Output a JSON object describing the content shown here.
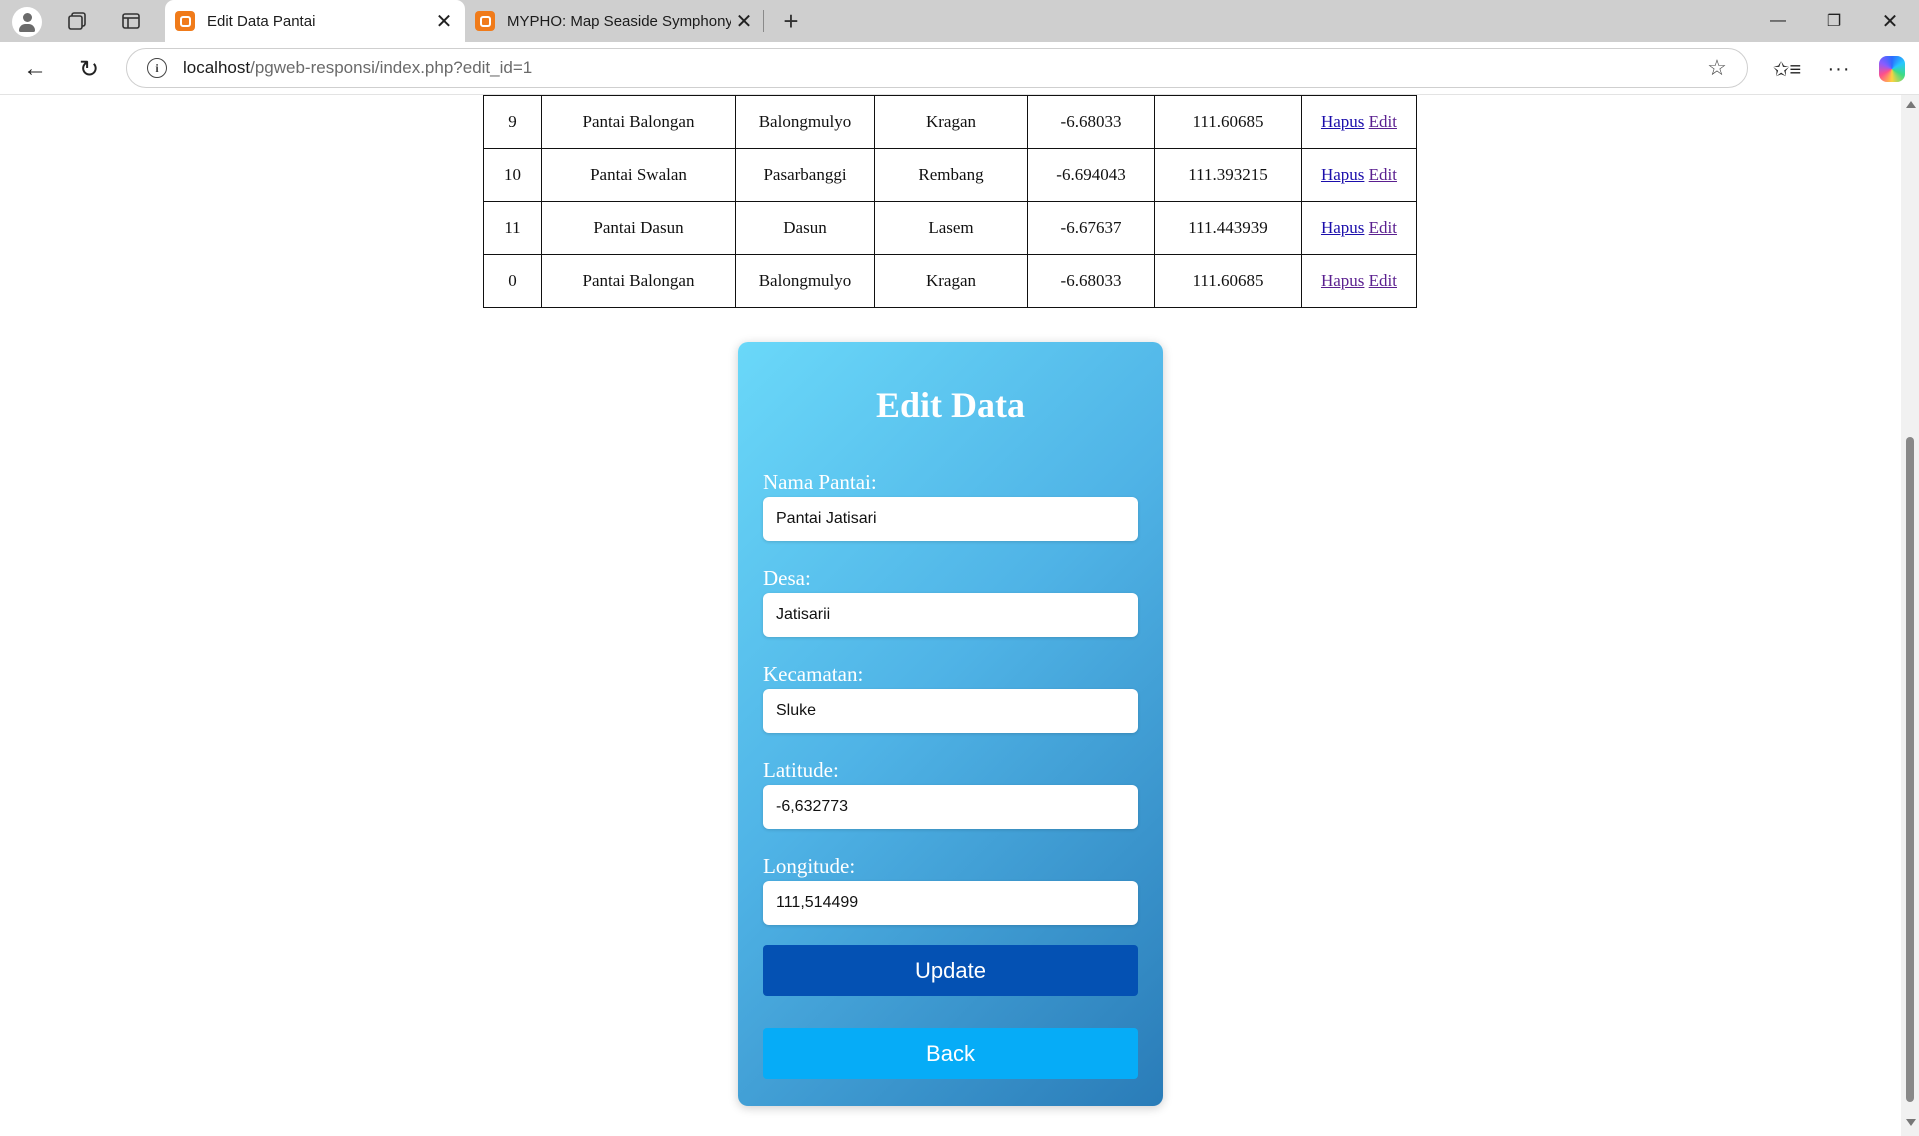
{
  "browser": {
    "tabs": [
      {
        "title": "Edit Data Pantai",
        "active": true
      },
      {
        "title": "MYPHO: Map Seaside Symphony",
        "active": false
      }
    ],
    "url_host": "localhost",
    "url_path": "/pgweb-responsi/index.php?edit_id=1",
    "icons": {
      "profile": "profile-icon",
      "collections": "collections-icon",
      "tab_actions": "tab-actions-icon",
      "new_tab": "plus-icon",
      "minimize": "minimize-icon",
      "maximize": "restore-icon",
      "close": "close-icon",
      "back": "arrow-left-icon",
      "reload": "reload-icon",
      "info": "info-icon",
      "favorite": "star-icon",
      "favorites_bar": "favorites-icon",
      "more": "more-icon",
      "copilot": "copilot-icon"
    },
    "glyphs": {
      "close": "✕",
      "new_tab": "+",
      "minimize": "—",
      "maximize": "❐",
      "back": "←",
      "reload": "↻",
      "info": "i",
      "star": "☆",
      "favorites": "✩≡",
      "more": "···"
    }
  },
  "table": {
    "rows": [
      {
        "id": "9",
        "nama": "Pantai Balongan",
        "desa": "Balongmulyo",
        "kecamatan": "Kragan",
        "lat": "-6.68033",
        "lon": "111.60685",
        "hapus": "Hapus",
        "edit": "Edit"
      },
      {
        "id": "10",
        "nama": "Pantai Swalan",
        "desa": "Pasarbanggi",
        "kecamatan": "Rembang",
        "lat": "-6.694043",
        "lon": "111.393215",
        "hapus": "Hapus",
        "edit": "Edit"
      },
      {
        "id": "11",
        "nama": "Pantai Dasun",
        "desa": "Dasun",
        "kecamatan": "Lasem",
        "lat": "-6.67637",
        "lon": "111.443939",
        "hapus": "Hapus",
        "edit": "Edit"
      },
      {
        "id": "0",
        "nama": "Pantai Balongan",
        "desa": "Balongmulyo",
        "kecamatan": "Kragan",
        "lat": "-6.68033",
        "lon": "111.60685",
        "hapus": "Hapus",
        "edit": "Edit"
      }
    ]
  },
  "form": {
    "title": "Edit Data",
    "fields": [
      {
        "label": "Nama Pantai:",
        "value": "Pantai Jatisari"
      },
      {
        "label": "Desa:",
        "value": "Jatisarii"
      },
      {
        "label": "Kecamatan:",
        "value": "Sluke"
      },
      {
        "label": "Latitude:",
        "value": "-6,632773"
      },
      {
        "label": "Longitude:",
        "value": "111,514499"
      }
    ],
    "update_label": "Update",
    "back_label": "Back"
  },
  "colors": {
    "update_button": "#0451b3",
    "back_button": "#06acf7",
    "card_gradient_start": "#6ad8f9",
    "card_gradient_end": "#2a7cb8"
  }
}
